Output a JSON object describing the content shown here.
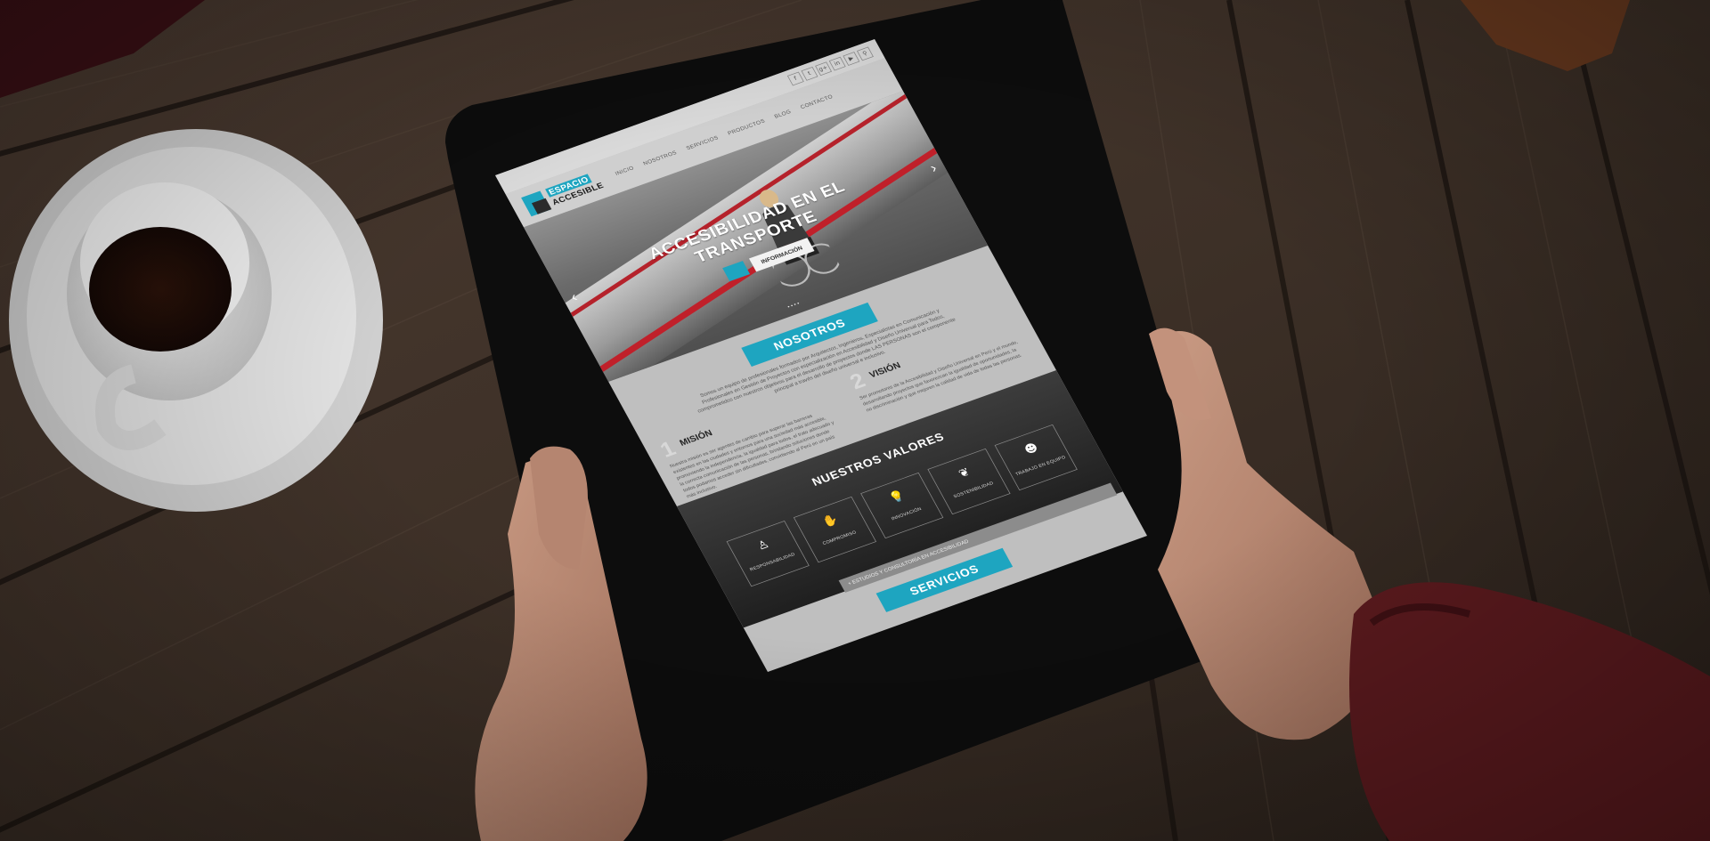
{
  "website": {
    "logo": {
      "line1": "ESPACIO",
      "line2": "ACCESIBLE"
    },
    "social_icons": [
      "facebook-icon",
      "twitter-icon",
      "google-plus-icon",
      "linkedin-icon",
      "youtube-icon",
      "search-icon"
    ],
    "social_glyphs": [
      "f",
      "t",
      "g+",
      "in",
      "▶",
      "⚲"
    ],
    "menu": [
      "INICIO",
      "NOSOTROS",
      "SERVICIOS",
      "PRODUCTOS",
      "BLOG",
      "CONTACTO"
    ],
    "hero": {
      "title_line1": "ACCESIBILIDAD EN EL",
      "title_line2": "TRANSPORTE",
      "button_primary": "",
      "button_secondary": "INFORMACIÓN",
      "arrow_left": "‹",
      "arrow_right": "›",
      "dots": "• • • •"
    },
    "nosotros": {
      "heading": "NOSOTROS",
      "intro": "Somos un equipo de profesionales formados por Arquitectos, Ingenieros, Especialistas en Comunicación y Profesionales en Gestión de Proyectos con especialización en Accesibilidad y Diseño Universal para Todos, comprometidos con nuestros objetivos para el desarrollo de proyectos donde LAS PERSONAS son el componente principal a través del diseño universal e inclusivo.",
      "mision": {
        "number": "1",
        "title": "MISIÓN",
        "text": "Nuestra misión es ser agentes de cambio para superar las barreras existentes en las ciudades y entornos para una sociedad más accesible, promoviendo la independencia, la igualdad para todos, el trato adecuado y la correcta comunicación de las personas, brindando soluciones donde todos podamos acceder sin dificultades, convirtiendo al Perú en un país más inclusivo."
      },
      "vision": {
        "number": "2",
        "title": "VISIÓN",
        "text": "Ser promotores de la Accesibilidad y Diseño Universal en Perú y el mundo, desarrollando proyectos que favorezcan la igualdad de oportunidades, la no discriminación y que mejoren la calidad de vida de todas las personas."
      }
    },
    "valores": {
      "heading": "NUESTROS VALORES",
      "items": [
        {
          "label": "RESPONSABILIDAD",
          "icon": "person-icon",
          "glyph": "♙"
        },
        {
          "label": "COMPROMISO",
          "icon": "handshake-icon",
          "glyph": "✋"
        },
        {
          "label": "INNOVACIÓN",
          "icon": "lightbulb-icon",
          "glyph": "💡"
        },
        {
          "label": "SOSTENIBILIDAD",
          "icon": "leaf-icon",
          "glyph": "❦"
        },
        {
          "label": "TRABAJO EN EQUIPO",
          "icon": "team-icon",
          "glyph": "☻"
        }
      ]
    },
    "servicios": {
      "heading": "SERVICIOS",
      "accordion_first": "ESTUDIOS Y CONSULTORÍA EN ACCESIBILIDAD",
      "accordion_icon": "+"
    }
  },
  "colors": {
    "accent": "#1ea5c0",
    "red_stripe": "#c0202a",
    "sleeve": "#5c1a1e",
    "wood": "#3b2c22"
  }
}
